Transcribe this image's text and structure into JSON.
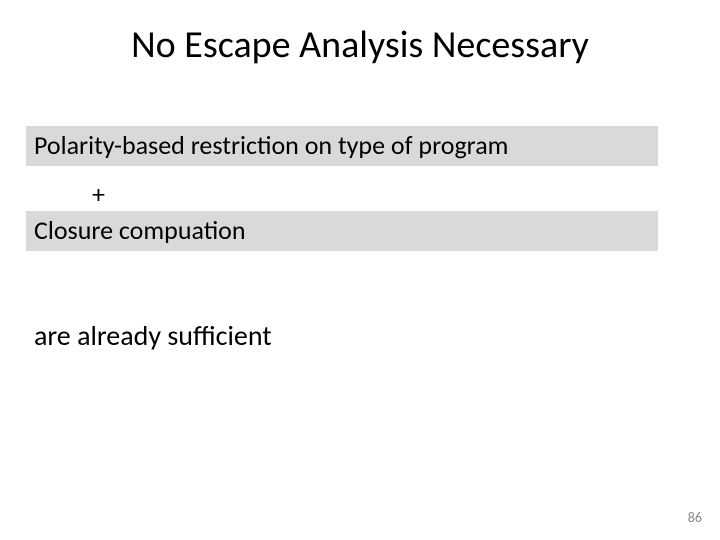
{
  "title": "No Escape Analysis Necessary",
  "box1": "Polarity-based restriction on type of program",
  "plus": "+",
  "box2": "Closure compuation",
  "sufficient": "are already sufficient",
  "page_number": "86"
}
